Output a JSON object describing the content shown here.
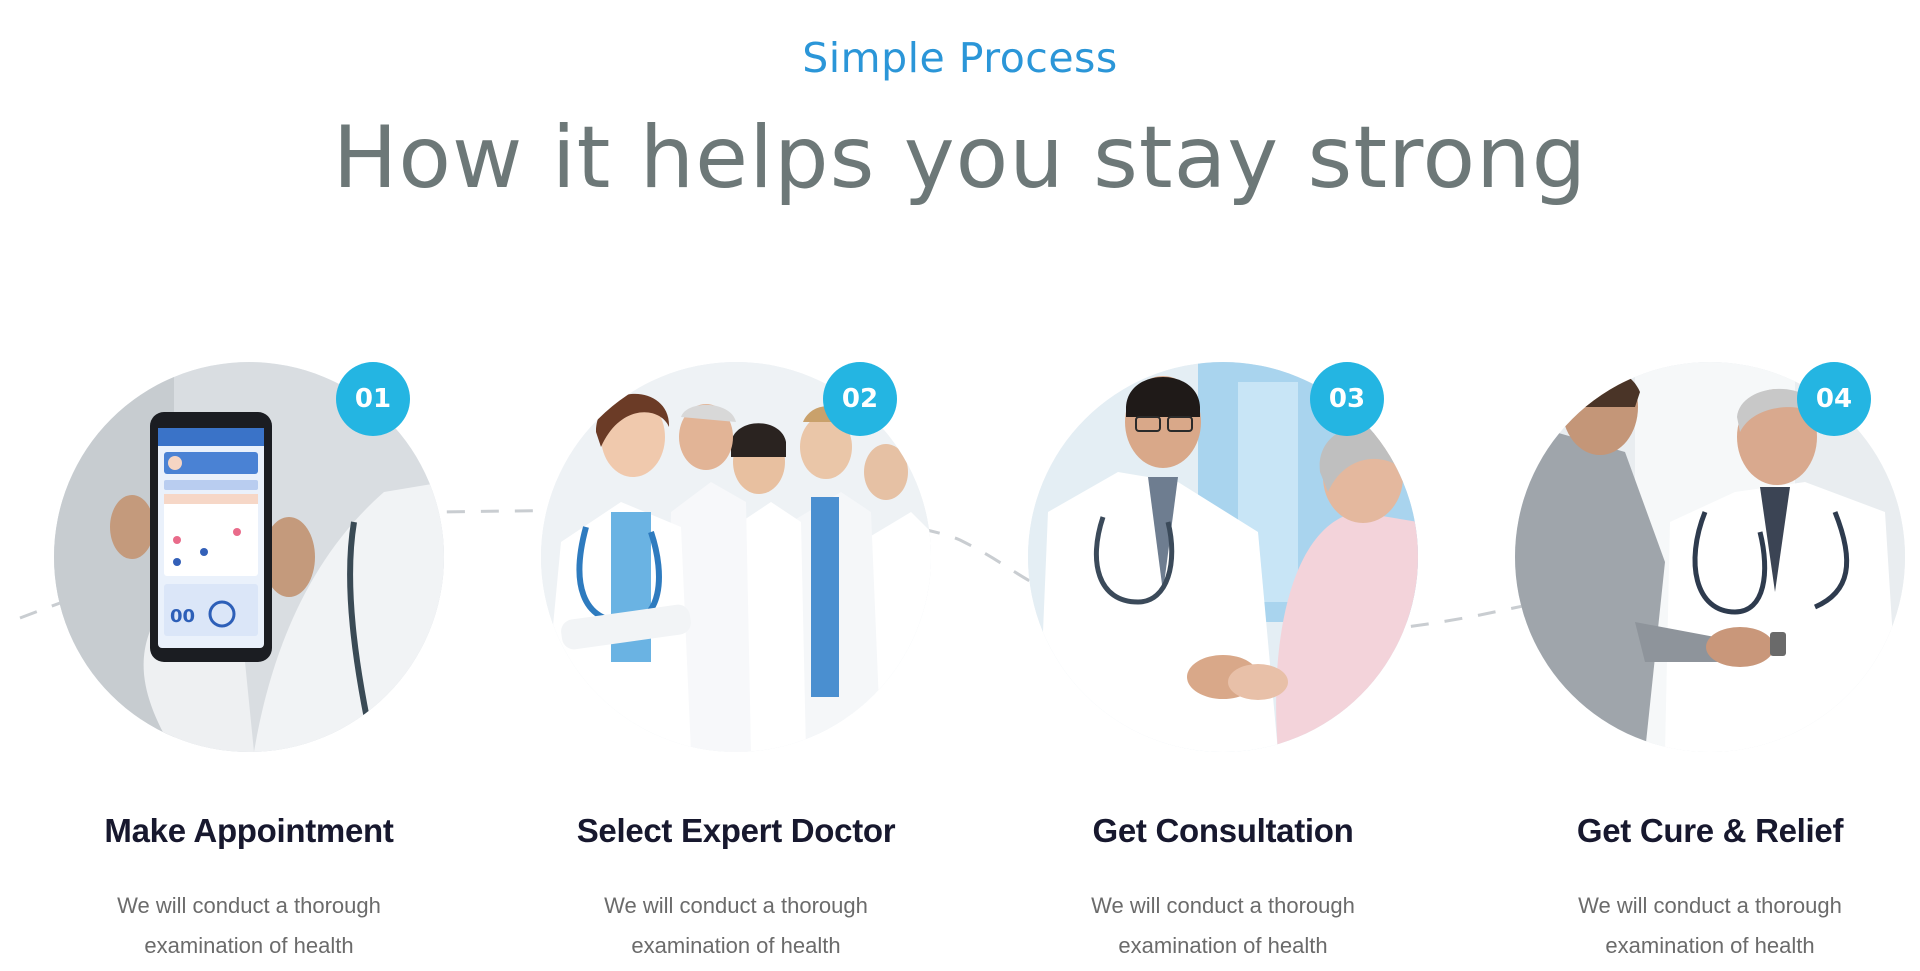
{
  "section": {
    "eyebrow": "Simple Process",
    "headline": "How it helps you stay strong"
  },
  "colors": {
    "accent": "#2b96d8",
    "badge": "#24b5e2",
    "headline": "#6d7878",
    "title": "#17182e",
    "body": "#6b6b6b"
  },
  "steps": [
    {
      "number": "01",
      "title": "Make Appointment",
      "desc_line1": "We will conduct a thorough",
      "desc_line2": "examination of health",
      "photo": "doctor-holding-phone-booking-app"
    },
    {
      "number": "02",
      "title": "Select Expert Doctor",
      "desc_line1": "We will conduct a thorough",
      "desc_line2": "examination of health",
      "photo": "group-of-medical-team"
    },
    {
      "number": "03",
      "title": "Get Consultation",
      "desc_line1": "We will conduct a thorough",
      "desc_line2": "examination of health",
      "photo": "doctor-consulting-elderly-patient"
    },
    {
      "number": "04",
      "title": "Get Cure & Relief",
      "desc_line1": "We will conduct a thorough",
      "desc_line2": "examination of health",
      "photo": "doctor-shaking-hands-with-patient"
    }
  ]
}
